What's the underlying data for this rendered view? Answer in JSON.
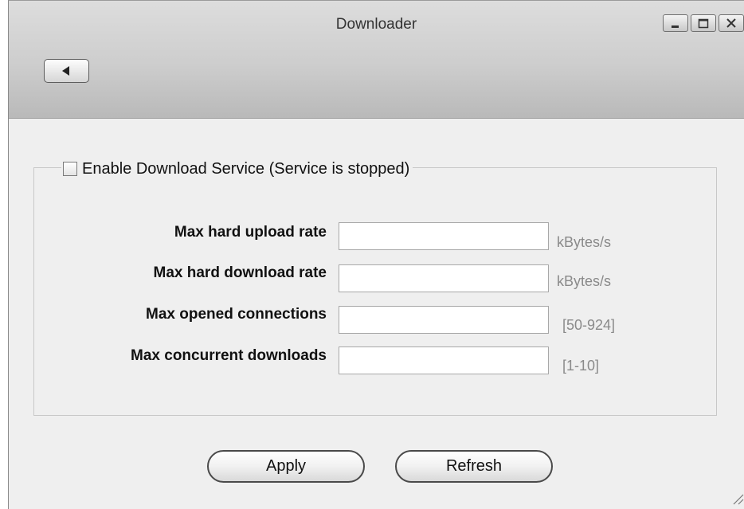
{
  "window": {
    "title": "Downloader",
    "controls": [
      {
        "name": "minimize-icon"
      },
      {
        "name": "maximize-icon"
      },
      {
        "name": "close-icon"
      }
    ],
    "back_icon": "triangle-left-icon"
  },
  "service": {
    "enabled": false,
    "label": "Enable Download Service (Service is stopped)"
  },
  "fields": [
    {
      "label": "Max hard upload rate",
      "value": "",
      "unit": "kBytes/s"
    },
    {
      "label": "Max hard download rate",
      "value": "",
      "unit": "kBytes/s"
    },
    {
      "label": "Max opened connections",
      "value": "",
      "unit": "[50-924]"
    },
    {
      "label": "Max concurrent downloads",
      "value": "",
      "unit": "[1-10]"
    }
  ],
  "actions": {
    "apply_label": "Apply",
    "refresh_label": "Refresh"
  }
}
